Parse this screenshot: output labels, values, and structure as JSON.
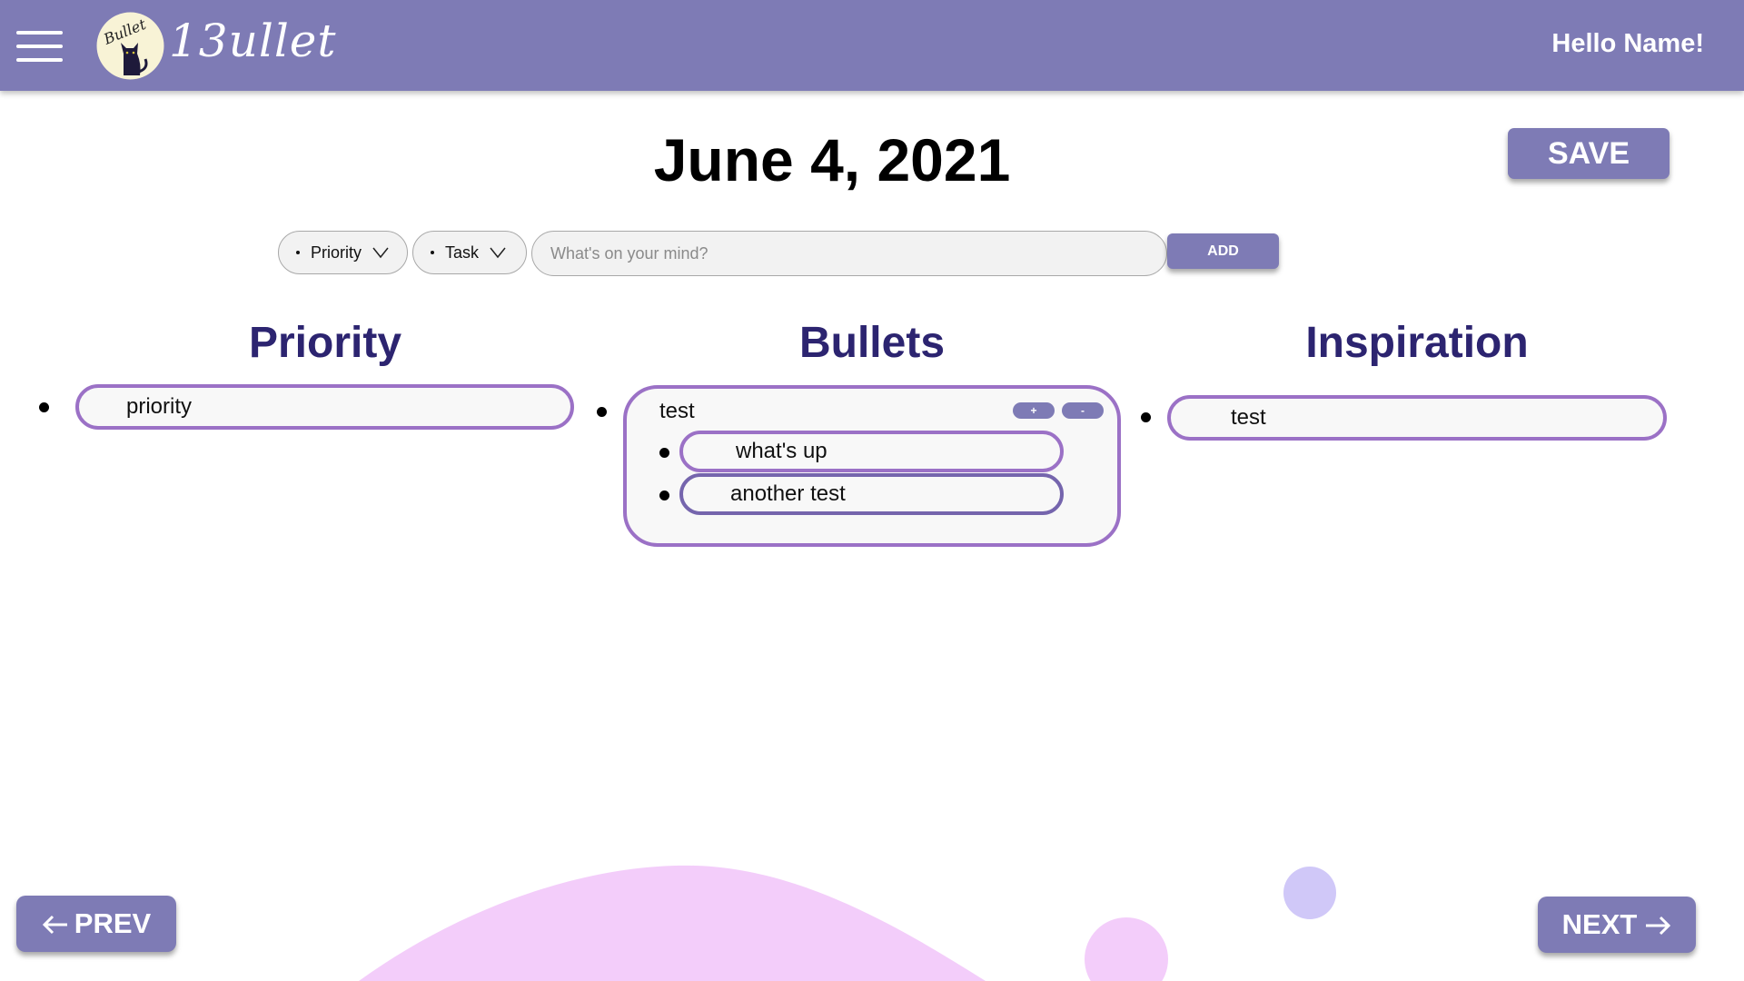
{
  "header": {
    "app_name": "13ullet",
    "logo_text": "Bullet",
    "greeting": "Hello Name!",
    "icons": [
      "hamburger-menu-icon",
      "cat-logo-icon"
    ]
  },
  "page": {
    "date": "June 4, 2021",
    "save_label": "SAVE"
  },
  "composer": {
    "priority_select": "Priority",
    "task_select": "Task",
    "placeholder": "What's on your mind?",
    "add_label": "ADD"
  },
  "columns": {
    "priority": {
      "title": "Priority",
      "items": [
        "priority"
      ]
    },
    "bullets": {
      "title": "Bullets",
      "group": {
        "label": "test",
        "plus_label": "+",
        "minus_label": "-",
        "children": [
          "what's up",
          "another test"
        ]
      }
    },
    "inspiration": {
      "title": "Inspiration",
      "items": [
        "test"
      ]
    }
  },
  "footer": {
    "prev_label": "PREV",
    "next_label": "NEXT"
  },
  "colors": {
    "header": "#7e7bb5",
    "title_text": "#2c2470",
    "pill_border": "#9b71c6",
    "decor_pink": "#f3cdfa",
    "decor_lavender": "#d0c8f8"
  }
}
